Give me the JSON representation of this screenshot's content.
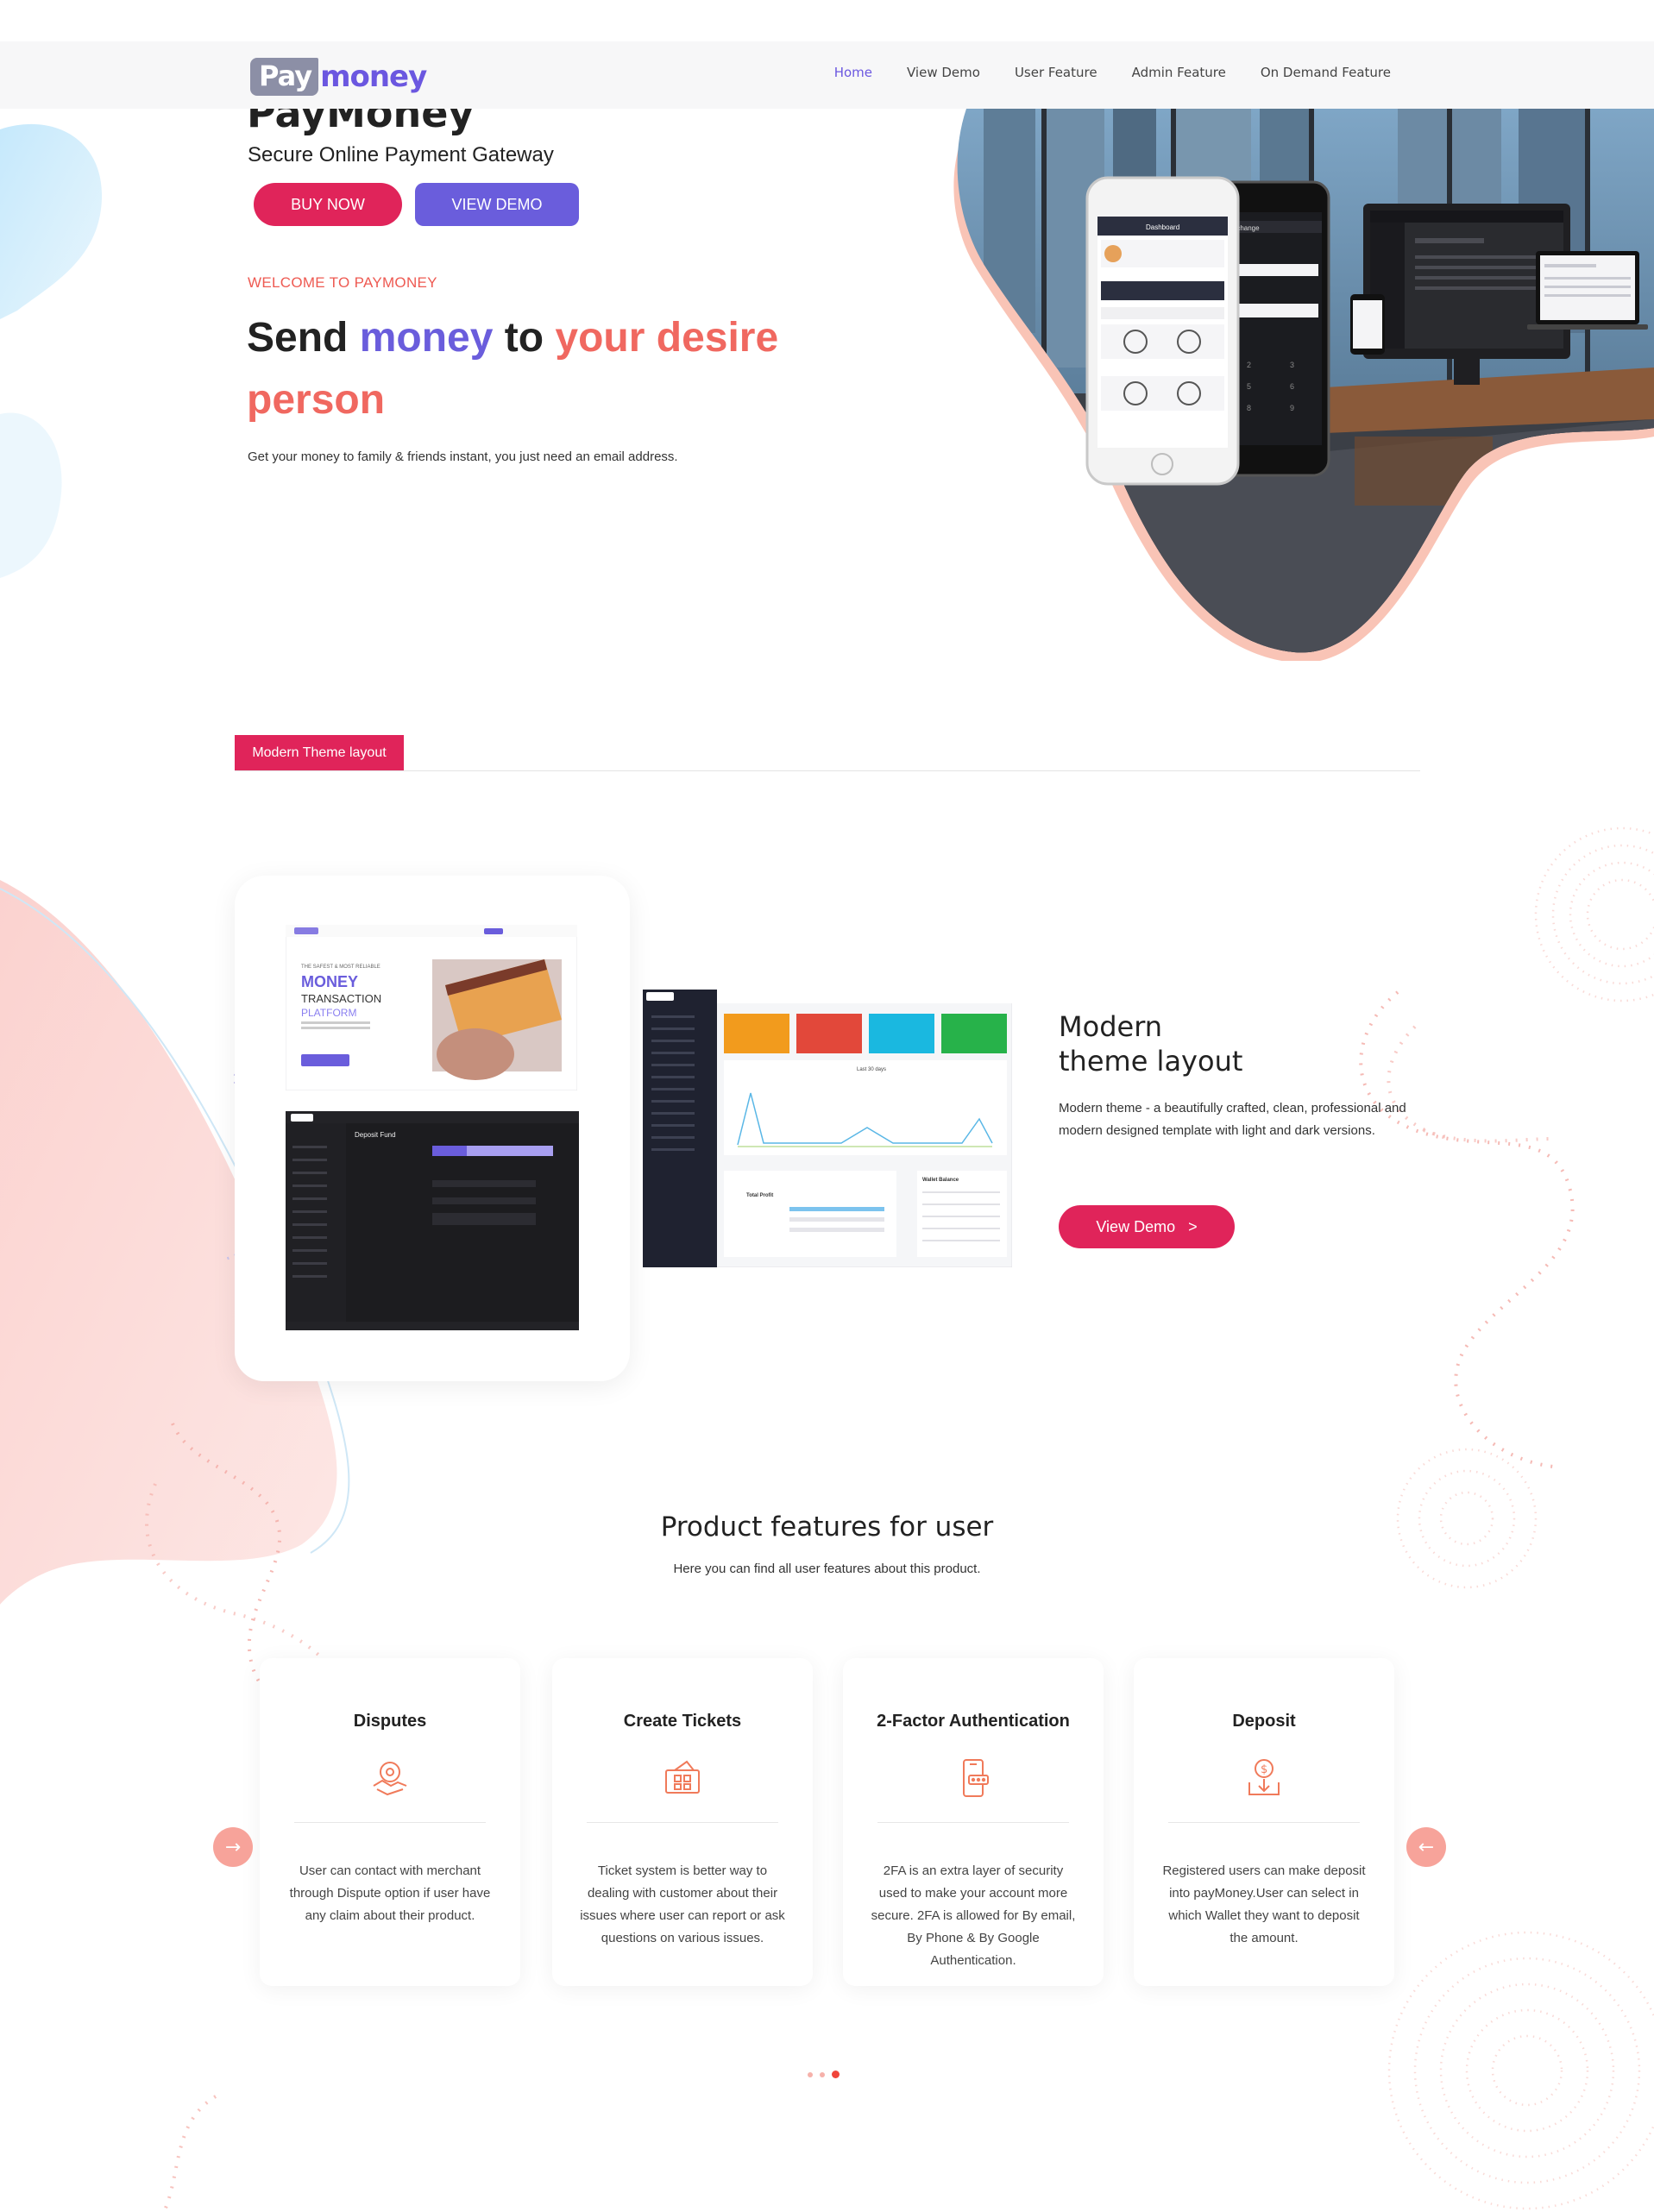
{
  "nav": {
    "logo_box": "Pay",
    "logo_rest": "money",
    "links": [
      "Home",
      "View Demo",
      "User Feature",
      "Admin Feature",
      "On Demand Feature"
    ],
    "active": "Home"
  },
  "hero": {
    "title": "PayMoney",
    "subtitle": "Secure Online Payment Gateway",
    "buy_label": "BUY NOW",
    "demo_label": "VIEW DEMO",
    "welcome": "WELCOME TO PAYMONEY",
    "headline_1": "Send ",
    "headline_2": "money",
    "headline_3": " to ",
    "headline_4": "your desire person",
    "description": "Get your money to family & friends instant, you just need an email address.",
    "phone_screen_1": "Dashboard",
    "phone_screen_2": "Exchange"
  },
  "modern": {
    "tab_label": "Modern Theme layout",
    "title_line1": "Modern",
    "title_line2": "theme layout",
    "description": "Modern theme - a beautifully crafted, clean, professional and modern designed template with light and dark versions.",
    "button_label": "View Demo   >",
    "shot1_lines": [
      "MONEY",
      "TRANSACTION",
      "PLATFORM"
    ],
    "shot1_kicker": "THE SAFEST & MOST RELIABLE",
    "shot2_title": "Deposit Fund",
    "shot3_chart_title": "Last 30 days",
    "shot3_wallet": "Wallet Balance",
    "shot3_total": "Total Profit"
  },
  "features": {
    "title": "Product features for user",
    "subtitle": "Here you can find all user features about this product.",
    "cards": [
      {
        "title": "Disputes",
        "icon": "disputes-icon",
        "text": "User can contact with merchant through Dispute option if user have any claim about their product."
      },
      {
        "title": "Create Tickets",
        "icon": "ticket-icon",
        "text": "Ticket system is better way to dealing with customer about their issues where user can report or ask questions on various issues."
      },
      {
        "title": "2-Factor Authentication",
        "icon": "phone-auth-icon",
        "text": "2FA is an extra layer of security used to make your account more secure. 2FA is allowed for By email, By Phone & By Google Authentication."
      },
      {
        "title": "Deposit",
        "icon": "deposit-icon",
        "text": "Registered users can make deposit into payMoney.User can select in which Wallet they want to deposit the amount."
      }
    ],
    "prev_arrow": "→",
    "next_arrow": "←",
    "active_dot": 2
  },
  "colors": {
    "brand_purple": "#6a5ddc",
    "brand_red": "#e0245a",
    "accent_coral": "#f06860"
  }
}
